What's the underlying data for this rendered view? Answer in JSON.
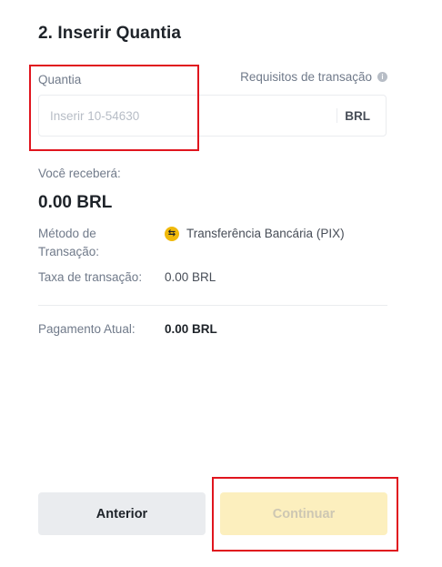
{
  "step": {
    "title": "2. Inserir Quantia"
  },
  "amount": {
    "label": "Quantia",
    "placeholder": "Inserir 10-54630",
    "value": "",
    "unit": "BRL"
  },
  "requirements": {
    "label": "Requisitos de transação",
    "icon": "info-icon"
  },
  "receive": {
    "label": "Você receberá:",
    "value": "0.00",
    "currency": "BRL"
  },
  "details": {
    "method_label_line1": "Método de",
    "method_label_line2": "Transação:",
    "method_value": "Transferência Bancária (PIX)",
    "method_icon": "swap-arrows-icon",
    "fee_label": "Taxa de transação:",
    "fee_value": "0.00 BRL",
    "payment_label": "Pagamento Atual:",
    "payment_value": "0.00 BRL"
  },
  "buttons": {
    "previous": "Anterior",
    "continue": "Continuar",
    "continue_enabled": false
  },
  "colors": {
    "accent": "#f0b90b",
    "disabled_button": "#fcefbe",
    "highlight_box": "#e0151e"
  }
}
